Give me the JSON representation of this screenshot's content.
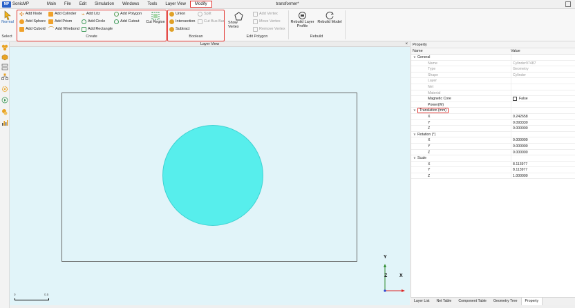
{
  "app": {
    "name": "SonicMP",
    "logo_text": "MP",
    "window_title": "transformer*"
  },
  "menu": [
    "Main",
    "File",
    "Edit",
    "Simulation",
    "Windows",
    "Tools",
    "Layer View",
    "Modify"
  ],
  "ribbon": {
    "select": {
      "normal_label": "Normal",
      "group_label": "Select"
    },
    "create": {
      "items": {
        "add_node": "Add Node",
        "add_cylinder": "Add Cylinder",
        "add_litz": "Add Litz",
        "add_polygon": "Add Polygon",
        "add_sphere": "Add Sphere",
        "add_prism": "Add Prism",
        "add_circle": "Add Circle",
        "add_cutout": "Add Cutout",
        "add_cuboid": "Add Cuboid",
        "add_wirebond": "Add Wirebond",
        "add_rectangle": "Add Rectangle",
        "cut_region": "Cut Region"
      },
      "group_label": "Create"
    },
    "boolean": {
      "union": "Union",
      "split": "Split",
      "intersection": "Intersection",
      "cut_bus_bar": "Cut Bus Bar",
      "subtract": "Subtract",
      "group_label": "Boolean"
    },
    "edit_polygon": {
      "show_vertex": "Show Vertex",
      "add_vertex": "Add Vertex",
      "move_vertex": "Move Vertex",
      "remove_vertex": "Remove Vertex",
      "group_label": "Edit Polygon"
    },
    "rebuild": {
      "rebuild_layer_profile": "Rebuild Layer Profile",
      "rebuild_model": "Rebuild Model",
      "group_label": "Rebuild"
    }
  },
  "layer_view": {
    "title": "Layer View",
    "close": "×",
    "axes": {
      "y": "Y",
      "z": "Z",
      "x": "X"
    },
    "scale": {
      "start": "0",
      "end": "0.5"
    }
  },
  "property_panel": {
    "title": "Property",
    "columns": {
      "name": "Name",
      "value": "Value"
    },
    "rows": [
      {
        "kind": "cat",
        "name": "General",
        "value": ""
      },
      {
        "kind": "sub",
        "dim": true,
        "name": "Name",
        "value": "Cylinder97487"
      },
      {
        "kind": "sub",
        "dim": true,
        "name": "Type",
        "value": "Geometry"
      },
      {
        "kind": "sub",
        "dim": true,
        "name": "Shape",
        "value": "Cylinder"
      },
      {
        "kind": "sub",
        "dim": true,
        "name": "Layer",
        "value": ""
      },
      {
        "kind": "sub",
        "dim": true,
        "name": "Net",
        "value": ""
      },
      {
        "kind": "sub",
        "dim": true,
        "name": "Material",
        "value": ""
      },
      {
        "kind": "sub",
        "name": "Magnetic Core",
        "value": "False",
        "checkbox": true
      },
      {
        "kind": "sub",
        "name": "Power(W)",
        "value": ""
      },
      {
        "kind": "cat",
        "name": "Translation (mm)",
        "value": "",
        "highlight": true
      },
      {
        "kind": "sub",
        "name": "X",
        "value": "0.242658"
      },
      {
        "kind": "sub",
        "name": "Y",
        "value": "0.093330"
      },
      {
        "kind": "sub",
        "name": "Z",
        "value": "0.000000"
      },
      {
        "kind": "cat",
        "name": "Rotation (°)",
        "value": ""
      },
      {
        "kind": "sub",
        "name": "X",
        "value": "0.000000"
      },
      {
        "kind": "sub",
        "name": "Y",
        "value": "0.000000"
      },
      {
        "kind": "sub",
        "name": "Z",
        "value": "0.000000"
      },
      {
        "kind": "cat",
        "name": "Scale",
        "value": ""
      },
      {
        "kind": "sub",
        "name": "X",
        "value": "8.113977"
      },
      {
        "kind": "sub",
        "name": "Y",
        "value": "8.113977"
      },
      {
        "kind": "sub",
        "name": "Z",
        "value": "1.000000"
      }
    ]
  },
  "bottom_tabs": [
    "Layer List",
    "Net Table",
    "Component Table",
    "Geometry Tree",
    "Property"
  ],
  "colors": {
    "accent_red": "#e2332f",
    "canvas_bg": "#e1f4f9",
    "circle_fill": "#57eeec"
  }
}
